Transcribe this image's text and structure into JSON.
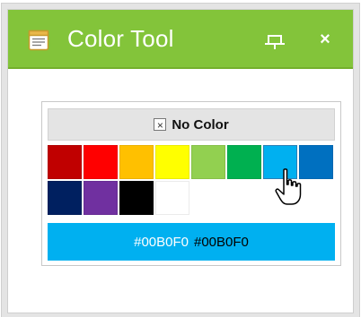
{
  "window": {
    "title": "Color Tool",
    "title_bar_color": "#83c43a",
    "close_glyph": "×"
  },
  "picker": {
    "no_color_label": "No Color",
    "no_color_glyph": "×",
    "swatches": [
      {
        "color": "#c00000"
      },
      {
        "color": "#ff0000"
      },
      {
        "color": "#ffc000"
      },
      {
        "color": "#ffff00"
      },
      {
        "color": "#92d050"
      },
      {
        "color": "#00b050"
      },
      {
        "color": "#00b0f0",
        "selected": true
      },
      {
        "color": "#0070c0"
      },
      {
        "color": "#002060"
      },
      {
        "color": "#7030a0"
      },
      {
        "color": "#000000"
      },
      {
        "color": "#ffffff"
      }
    ],
    "preview_color": "#00b0f0",
    "preview_hex_light": "#00B0F0",
    "preview_hex_dark": "#00B0F0"
  },
  "icons": {
    "title_icon": "notepad-icon",
    "pin_icon": "pin-icon",
    "close_icon": "close-icon",
    "cursor": "hand-pointer-icon"
  }
}
